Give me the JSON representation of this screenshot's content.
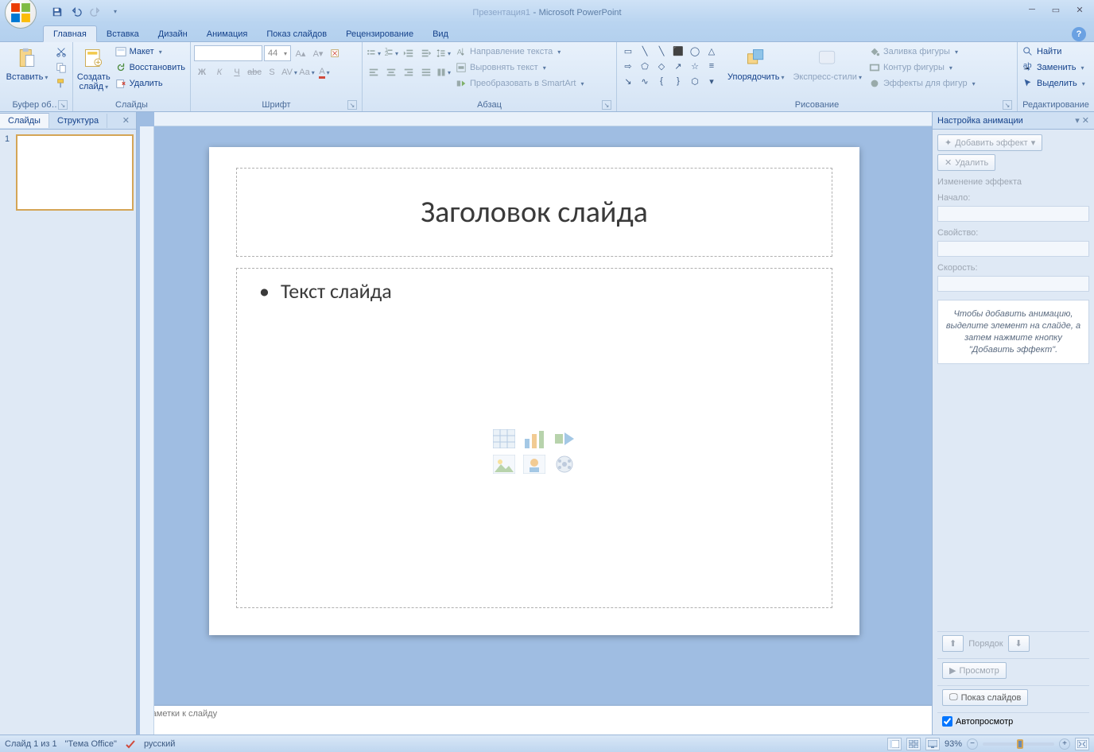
{
  "title": {
    "doc": "Презентация1",
    "app": "Microsoft PowerPoint"
  },
  "tabs": [
    "Главная",
    "Вставка",
    "Дизайн",
    "Анимация",
    "Показ слайдов",
    "Рецензирование",
    "Вид"
  ],
  "ribbon": {
    "clipboard": {
      "paste": "Вставить",
      "label": "Буфер об…"
    },
    "slides": {
      "new": "Создать\nслайд",
      "layout": "Макет",
      "reset": "Восстановить",
      "delete": "Удалить",
      "label": "Слайды"
    },
    "font": {
      "size": "44",
      "label": "Шрифт"
    },
    "paragraph": {
      "textdir": "Направление текста",
      "align": "Выровнять текст",
      "smartart": "Преобразовать в SmartArt",
      "label": "Абзац"
    },
    "drawing": {
      "arrange": "Упорядочить",
      "styles": "Экспресс-стили",
      "fill": "Заливка фигуры",
      "outline": "Контур фигуры",
      "effects": "Эффекты для фигур",
      "label": "Рисование"
    },
    "editing": {
      "find": "Найти",
      "replace": "Заменить",
      "select": "Выделить",
      "label": "Редактирование"
    }
  },
  "leftpane": {
    "tab_slides": "Слайды",
    "tab_outline": "Структура",
    "slide_num": "1"
  },
  "slide": {
    "title": "Заголовок слайда",
    "body": "Текст слайда"
  },
  "notes": {
    "placeholder": "Заметки к слайду"
  },
  "rightpane": {
    "title": "Настройка анимации",
    "add": "Добавить эффект",
    "remove": "Удалить",
    "change": "Изменение эффекта",
    "start": "Начало:",
    "property": "Свойство:",
    "speed": "Скорость:",
    "hint": "Чтобы добавить анимацию, выделите элемент на слайде, а затем нажмите кнопку \"Добавить эффект\".",
    "order": "Порядок",
    "preview": "Просмотр",
    "slideshow": "Показ слайдов",
    "autopreview": "Автопросмотр"
  },
  "statusbar": {
    "slide": "Слайд 1 из 1",
    "theme": "\"Тema Office\"",
    "theme2": "\"Тема Office\"",
    "lang": "русский",
    "zoom": "93%"
  }
}
